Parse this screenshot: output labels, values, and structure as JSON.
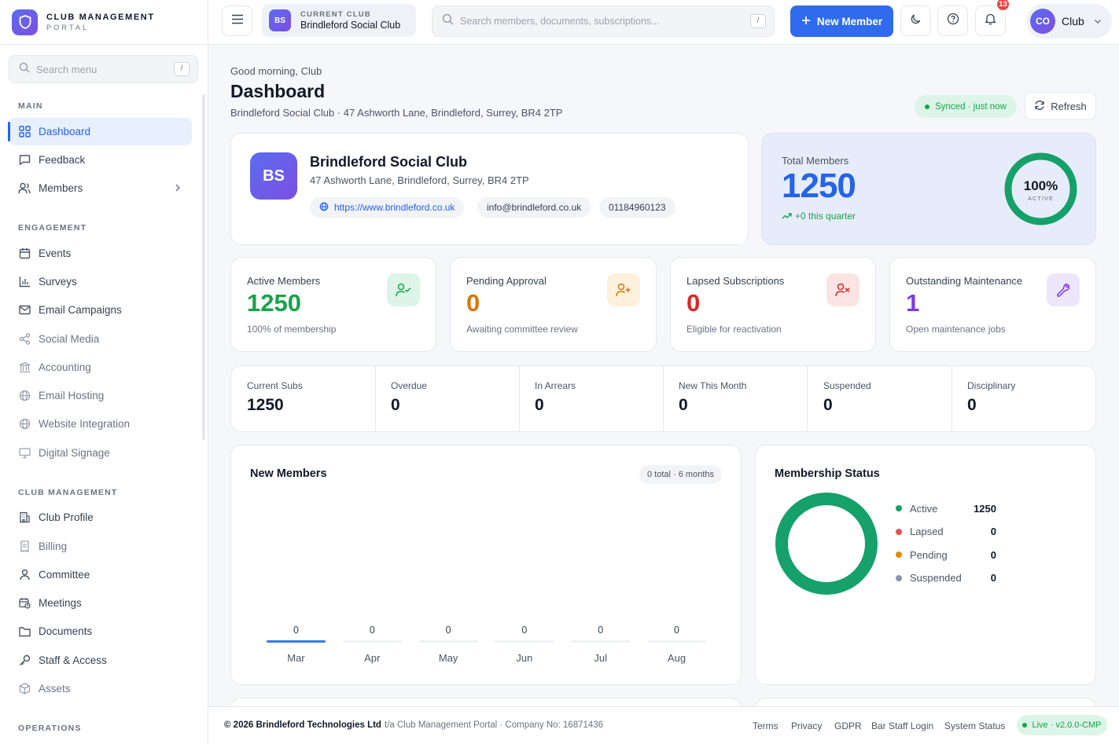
{
  "brand": {
    "title": "CLUB MANAGEMENT",
    "subtitle": "PORTAL"
  },
  "sidebar": {
    "search_placeholder": "Search menu",
    "search_key": "/",
    "sections": [
      "MAIN",
      "ENGAGEMENT",
      "CLUB MANAGEMENT",
      "OPERATIONS"
    ],
    "items": [
      {
        "label": "Dashboard",
        "icon": "grid-icon"
      },
      {
        "label": "Feedback",
        "icon": "chat-icon"
      },
      {
        "label": "Members",
        "icon": "users-icon"
      },
      {
        "label": "Events",
        "icon": "calendar-icon"
      },
      {
        "label": "Surveys",
        "icon": "bar-chart-icon"
      },
      {
        "label": "Email Campaigns",
        "icon": "mail-icon"
      },
      {
        "label": "Social Media",
        "icon": "share-icon"
      },
      {
        "label": "Accounting",
        "icon": "bank-icon"
      },
      {
        "label": "Email Hosting",
        "icon": "globe-icon"
      },
      {
        "label": "Website Integration",
        "icon": "globe-icon"
      },
      {
        "label": "Digital Signage",
        "icon": "monitor-icon"
      },
      {
        "label": "Club Profile",
        "icon": "building-icon"
      },
      {
        "label": "Billing",
        "icon": "receipt-icon"
      },
      {
        "label": "Committee",
        "icon": "user-icon"
      },
      {
        "label": "Meetings",
        "icon": "calendar-clock-icon"
      },
      {
        "label": "Documents",
        "icon": "folder-icon"
      },
      {
        "label": "Staff & Access",
        "icon": "key-icon"
      },
      {
        "label": "Assets",
        "icon": "box-icon"
      }
    ]
  },
  "topbar": {
    "club_label": "CURRENT CLUB",
    "club_name": "Brindleford Social Club",
    "club_initials": "BS",
    "search_placeholder": "Search members, documents, subscriptions...",
    "search_key": "/",
    "new_member": "New Member",
    "notifications": "13",
    "user_initials": "CO",
    "user_name": "Club"
  },
  "header": {
    "greeting": "Good morning, Club",
    "title": "Dashboard",
    "subtitle": "Brindleford Social Club · 47 Ashworth Lane, Brindleford, Surrey, BR4 2TP",
    "synced": "Synced · just now",
    "refresh": "Refresh"
  },
  "club": {
    "initials": "BS",
    "name": "Brindleford Social Club",
    "address": "47 Ashworth Lane, Brindleford, Surrey, BR4 2TP",
    "website": "https://www.brindleford.co.uk",
    "email": "info@brindleford.co.uk",
    "phone": "01184960123"
  },
  "total": {
    "label": "Total Members",
    "value": "1250",
    "delta": "+0 this quarter",
    "percent": "100%",
    "percent_label": "ACTIVE",
    "ring_fraction": 1.0
  },
  "stats": [
    {
      "label": "Active Members",
      "value": "1250",
      "sub": "100% of membership",
      "color": "#16a34a",
      "icon": "user-check-icon"
    },
    {
      "label": "Pending Approval",
      "value": "0",
      "sub": "Awaiting committee review",
      "color": "#d97706",
      "icon": "user-plus-icon"
    },
    {
      "label": "Lapsed Subscriptions",
      "value": "0",
      "sub": "Eligible for reactivation",
      "color": "#dc2626",
      "icon": "user-x-icon"
    },
    {
      "label": "Outstanding Maintenance",
      "value": "1",
      "sub": "Open maintenance jobs",
      "color": "#7c3aed",
      "icon": "wrench-icon"
    }
  ],
  "metrics": [
    {
      "label": "Current Subs",
      "value": "1250"
    },
    {
      "label": "Overdue",
      "value": "0"
    },
    {
      "label": "In Arrears",
      "value": "0"
    },
    {
      "label": "New This Month",
      "value": "0"
    },
    {
      "label": "Suspended",
      "value": "0"
    },
    {
      "label": "Disciplinary",
      "value": "0"
    }
  ],
  "new_members": {
    "title": "New Members",
    "chip": "0 total · 6 months"
  },
  "membership_status": {
    "title": "Membership Status"
  },
  "chart_data": [
    {
      "type": "bar",
      "title": "New Members",
      "categories": [
        "Mar",
        "Apr",
        "May",
        "Jun",
        "Jul",
        "Aug"
      ],
      "values": [
        0,
        0,
        0,
        0,
        0,
        0
      ],
      "data_labels": [
        "0",
        "0",
        "0",
        "0",
        "0",
        "0"
      ]
    },
    {
      "type": "pie",
      "title": "Membership Status",
      "categories": [
        "Active",
        "Lapsed",
        "Pending",
        "Suspended"
      ],
      "values": [
        1250,
        0,
        0,
        0
      ],
      "data_labels": [
        "1250",
        "0",
        "0",
        "0"
      ],
      "colors": [
        "#16a06a",
        "#e05252",
        "#d98f0b",
        "#8a94a6"
      ],
      "legend": "right"
    }
  ],
  "footer": {
    "copyright": "© 2026 Brindleford Technologies Ltd",
    "ta": "t/a Club Management Portal · Company No: 16871436",
    "links": [
      "Terms",
      "Privacy",
      "GDPR",
      "Bar Staff Login",
      "System Status"
    ],
    "live": "Live · v2.0.0-CMP"
  }
}
